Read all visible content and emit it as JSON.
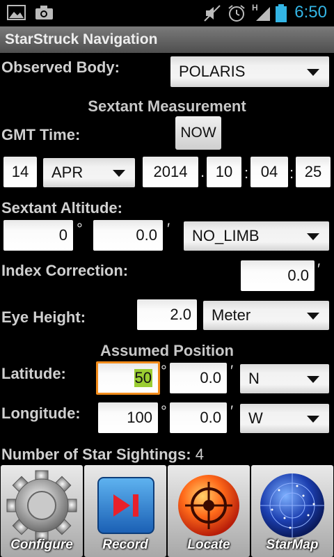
{
  "status": {
    "time": "6:50",
    "network": "H"
  },
  "app": {
    "title": "StarStruck Navigation"
  },
  "observed_body": {
    "label": "Observed Body:",
    "value": "POLARIS"
  },
  "sextant": {
    "header": "Sextant Measurement",
    "gmt_label": "GMT Time:",
    "now_button": "NOW",
    "day": "14",
    "month": "APR",
    "year": "2014",
    "hour": "10",
    "minute": "04",
    "second": "25",
    "altitude_label": "Sextant Altitude:",
    "alt_degrees": "0",
    "alt_minutes": "0.0",
    "limb": "NO_LIMB",
    "index_label": "Index Correction:",
    "index_value": "0.0",
    "eye_label": "Eye Height:",
    "eye_value": "2.0",
    "eye_unit": "Meter"
  },
  "assumed": {
    "header": "Assumed Position",
    "lat_label": "Latitude:",
    "lat_degrees": "50",
    "lat_minutes": "0.0",
    "lat_hemi": "N",
    "lon_label": "Longitude:",
    "lon_degrees": "100",
    "lon_minutes": "0.0",
    "lon_hemi": "W"
  },
  "sightings": {
    "label": "Number of Star Sightings:",
    "count": "4"
  },
  "symbols": {
    "degree": "°",
    "minute": "′",
    "date_dot": ".",
    "time_colon": ":"
  },
  "toolbar": {
    "configure": "Configure",
    "record": "Record",
    "locate": "Locate",
    "starmap": "StarMap"
  },
  "colors": {
    "accent": "#33b5e5",
    "focus": "#f28c1b",
    "highlight": "#9acd32"
  }
}
